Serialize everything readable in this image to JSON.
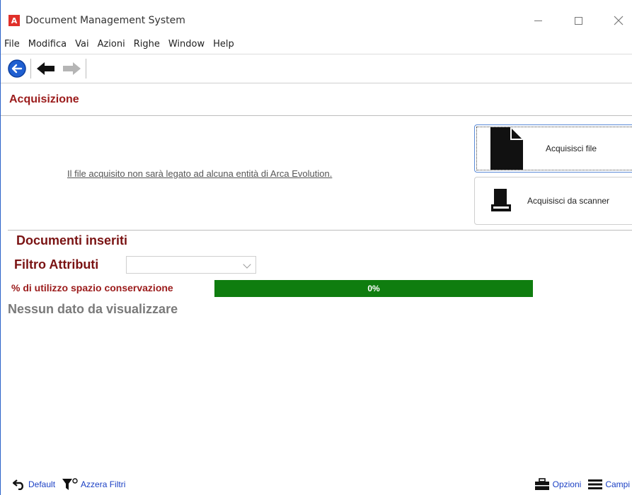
{
  "window": {
    "title": "Document Management System",
    "logo_letter": "A"
  },
  "menu": [
    "File",
    "Modifica",
    "Vai",
    "Azioni",
    "Righe",
    "Window",
    "Help"
  ],
  "toolbar": {
    "icons": [
      "back-circle-icon",
      "arrow-left-icon",
      "arrow-right-icon"
    ]
  },
  "section": {
    "title": "Acquisizione"
  },
  "acquisition": {
    "note": "Il file acquisito non sarà legato ad alcuna entità di Arca Evolution.",
    "file_button": "Acquisisci file",
    "scanner_button": "Acquisisci da scanner"
  },
  "documents": {
    "title": "Documenti inseriti",
    "filter_label": "Filtro Attributi",
    "filter_value": "",
    "usage_label": "% di utilizzo spazio conservazione",
    "usage_value": "0%",
    "usage_fraction": 0.0,
    "empty_message": "Nessun dato da visualizzare"
  },
  "footer": {
    "default_label": "Default",
    "clear_filters_label": "Azzera Filtri",
    "options_label": "Opzioni",
    "fields_label": "Campi"
  },
  "colors": {
    "accent_red": "#9b1b1b",
    "progress_green": "#0f7d0f",
    "link_blue": "#1a3fc4"
  }
}
